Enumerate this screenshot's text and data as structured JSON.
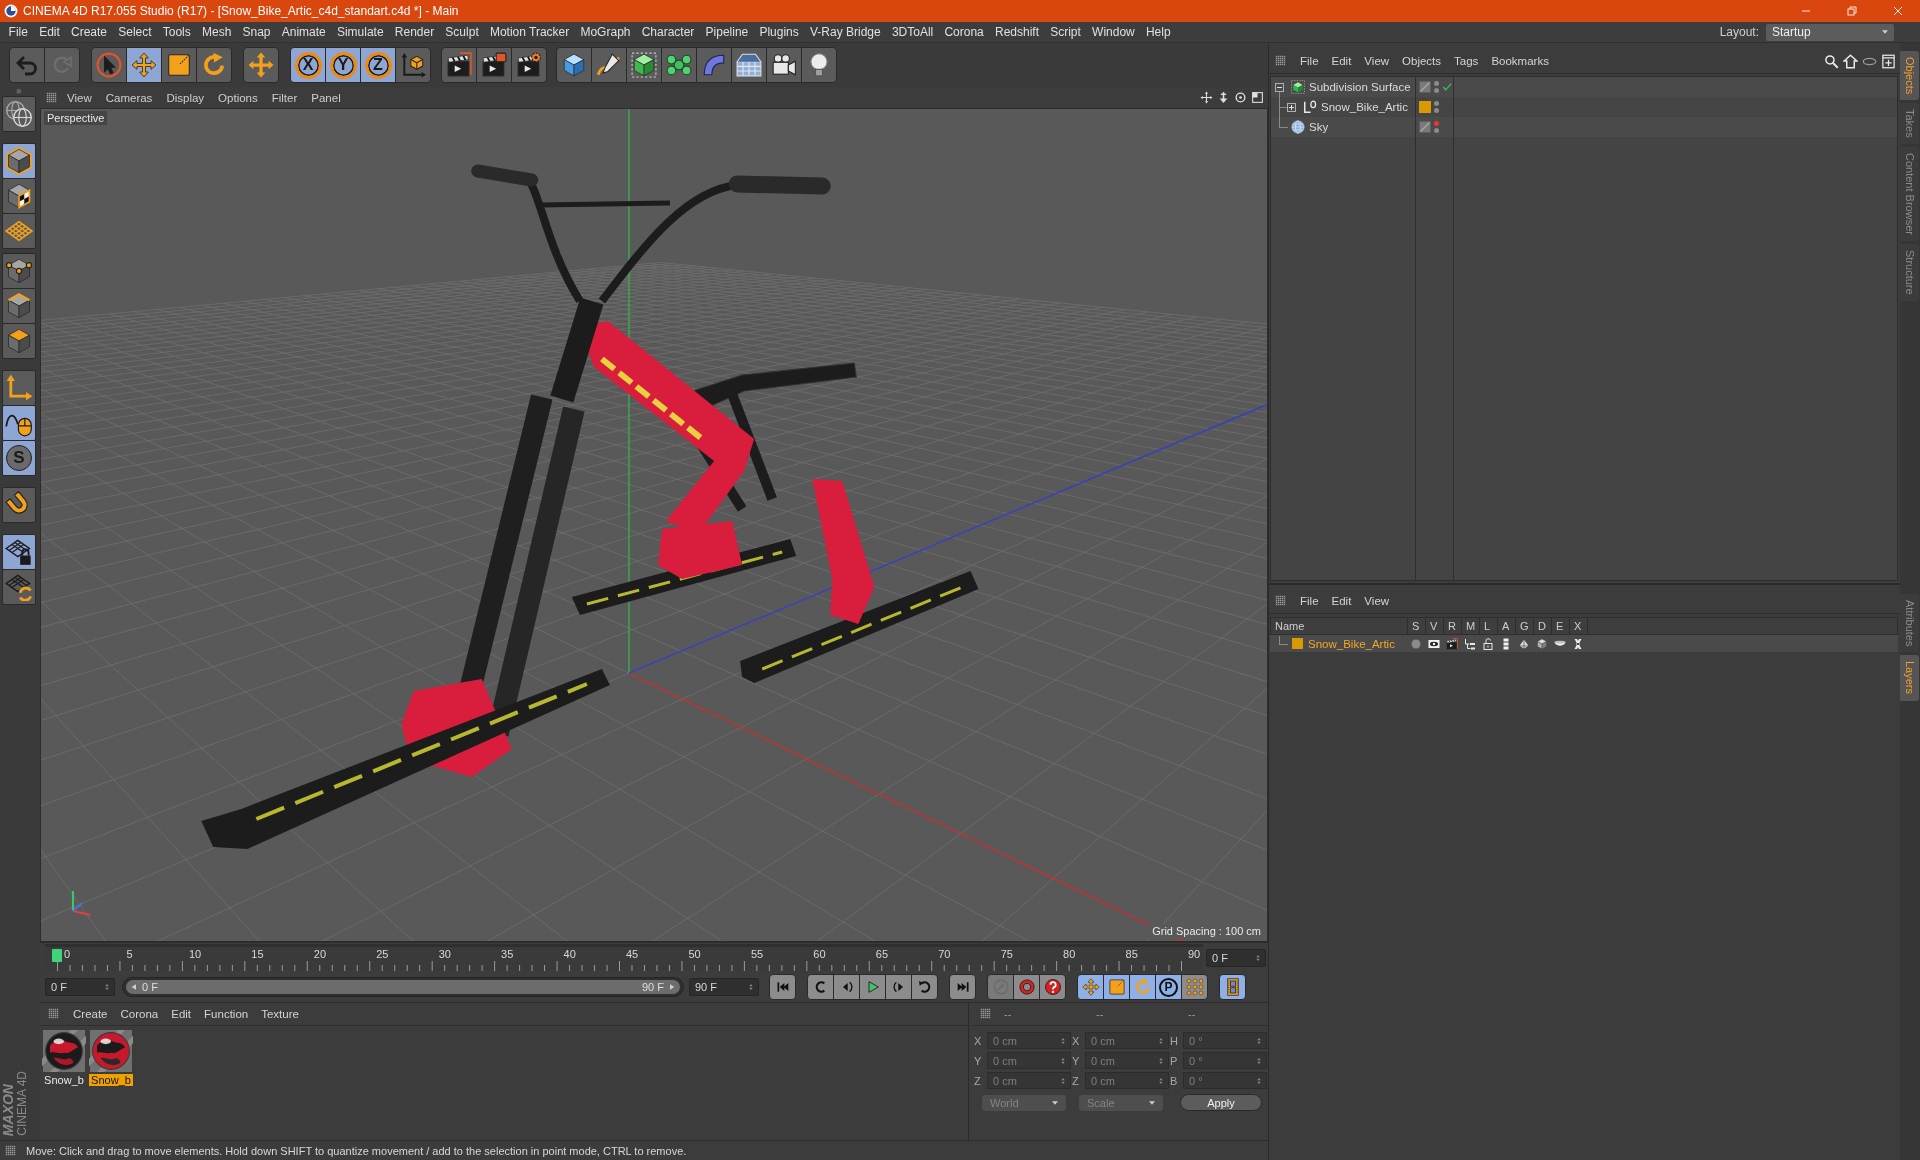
{
  "window": {
    "title": "CINEMA 4D R17.055 Studio (R17) - [Snow_Bike_Artic_c4d_standart.c4d *] - Main"
  },
  "menu_bar": {
    "items": [
      "File",
      "Edit",
      "Create",
      "Select",
      "Tools",
      "Mesh",
      "Snap",
      "Animate",
      "Simulate",
      "Render",
      "Sculpt",
      "Motion Tracker",
      "MoGraph",
      "Character",
      "Pipeline",
      "Plugins",
      "V-Ray Bridge",
      "3DToAll",
      "Corona",
      "Redshift",
      "Script",
      "Window",
      "Help"
    ],
    "layout_label": "Layout:",
    "layout_value": "Startup"
  },
  "toolbar": {
    "history": [
      {
        "kind": "undo",
        "disabled": false
      },
      {
        "kind": "redo",
        "disabled": true
      }
    ],
    "tools": [
      {
        "kind": "live-select",
        "selected": false
      },
      {
        "kind": "move",
        "selected": true
      },
      {
        "kind": "scale",
        "selected": false
      },
      {
        "kind": "rotate",
        "selected": false
      },
      {
        "kind": "recent",
        "selected": false
      }
    ],
    "axis_locks": [
      {
        "label": "X",
        "on": true
      },
      {
        "label": "Y",
        "on": true
      },
      {
        "label": "Z",
        "on": true
      }
    ]
  },
  "left_toolbar": {
    "groups": [
      [
        {
          "kind": "model",
          "selected": true
        },
        {
          "kind": "texture",
          "selected": false
        },
        {
          "kind": "workplane",
          "selected": false
        }
      ],
      [
        {
          "kind": "points",
          "selected": false
        },
        {
          "kind": "edges",
          "selected": false
        },
        {
          "kind": "polygons",
          "selected": false
        }
      ],
      [
        {
          "kind": "axis",
          "selected": false
        },
        {
          "kind": "tweak",
          "selected": true
        },
        {
          "kind": "snap",
          "label": "S",
          "selected": true
        }
      ],
      [
        {
          "kind": "magnet",
          "selected": false
        }
      ],
      [
        {
          "kind": "grid-lock",
          "selected": true
        },
        {
          "kind": "grid-rotate",
          "selected": false
        }
      ]
    ]
  },
  "viewport": {
    "menu": [
      "View",
      "Cameras",
      "Display",
      "Options",
      "Filter",
      "Panel"
    ],
    "camera": "Perspective",
    "grid_spacing": "Grid Spacing : 100 cm"
  },
  "timeline": {
    "ticks": [
      "0",
      "5",
      "10",
      "15",
      "20",
      "25",
      "30",
      "35",
      "40",
      "45",
      "50",
      "55",
      "60",
      "65",
      "70",
      "75",
      "80",
      "85",
      "90"
    ],
    "level": 0,
    "current_frame": "0 F"
  },
  "playback": {
    "start_field": "0 F",
    "range": {
      "start": "0 F",
      "end": "90 F",
      "level": 1
    },
    "end_field": "90 F",
    "record": [
      {
        "kind": "keyframe",
        "disabled": true
      },
      {
        "kind": "autokey",
        "disabled": false
      },
      {
        "kind": "keyframe-selection",
        "disabled": false
      }
    ],
    "modes": [
      {
        "kind": "position",
        "selected": true
      },
      {
        "kind": "scale",
        "selected": true
      },
      {
        "kind": "rotation",
        "selected": true
      },
      {
        "kind": "parameter",
        "label": "P",
        "selected": true
      },
      {
        "kind": "point-level",
        "selected": false
      }
    ],
    "timeline_button": {
      "selected": true
    }
  },
  "material_manager": {
    "menu": [
      "Create",
      "Corona",
      "Edit",
      "Function",
      "Texture"
    ],
    "materials": [
      {
        "name": "Snow_b",
        "selected": false
      },
      {
        "name": "Snow_b",
        "selected": true
      }
    ]
  },
  "coordinates": {
    "headers": [
      "--",
      "--",
      "--"
    ],
    "fields_disabled": true,
    "columns": [
      [
        {
          "axis": "X",
          "value": "0 cm"
        },
        {
          "axis": "Y",
          "value": "0 cm"
        },
        {
          "axis": "Z",
          "value": "0 cm"
        }
      ],
      [
        {
          "axis": "X",
          "value": "0 cm"
        },
        {
          "axis": "Y",
          "value": "0 cm"
        },
        {
          "axis": "Z",
          "value": "0 cm"
        }
      ],
      [
        {
          "axis": "H",
          "value": "0 °"
        },
        {
          "axis": "P",
          "value": "0 °"
        },
        {
          "axis": "B",
          "value": "0 °"
        }
      ]
    ],
    "dropdowns": [
      {
        "value": "World",
        "disabled": true
      },
      {
        "value": "Scale",
        "disabled": true
      }
    ],
    "apply": "Apply"
  },
  "object_manager": {
    "menu": [
      "File",
      "Edit",
      "View",
      "Objects",
      "Tags",
      "Bookmarks"
    ],
    "objects": [
      {
        "name": "Subdivision Surface",
        "kind": "subdivision",
        "expanded": true,
        "editor_hidden": false,
        "enabled": true,
        "children": [
          {
            "name": "Snow_Bike_Artic",
            "kind": "null",
            "expanded": false,
            "color": "#d89a00",
            "editor_hidden": false
          }
        ]
      },
      {
        "name": "Sky",
        "kind": "sky",
        "editor_hidden": true
      }
    ]
  },
  "layer_manager": {
    "menu": [
      "File",
      "Edit",
      "View"
    ],
    "columns": [
      "Name",
      "S",
      "V",
      "R",
      "M",
      "L",
      "A",
      "G",
      "D",
      "E",
      "X"
    ],
    "layers": [
      {
        "name": "Snow_Bike_Artic",
        "color": "#d89a00",
        "selected": true
      }
    ]
  },
  "side_tabs": {
    "upper": [
      {
        "label": "Objects",
        "selected": true
      },
      {
        "label": "Takes",
        "selected": false
      },
      {
        "label": "Content Browser",
        "selected": false
      },
      {
        "label": "Structure",
        "selected": false
      }
    ],
    "lower": [
      {
        "label": "Attributes",
        "selected": false
      },
      {
        "label": "Layers",
        "selected": true
      }
    ]
  },
  "status_bar": "Move: Click and drag to move elements. Hold down SHIFT to quantize movement / add to the selection in point mode, CTRL to remove.",
  "logo": {
    "brand": "MAXON",
    "product": "CINEMA 4D"
  }
}
